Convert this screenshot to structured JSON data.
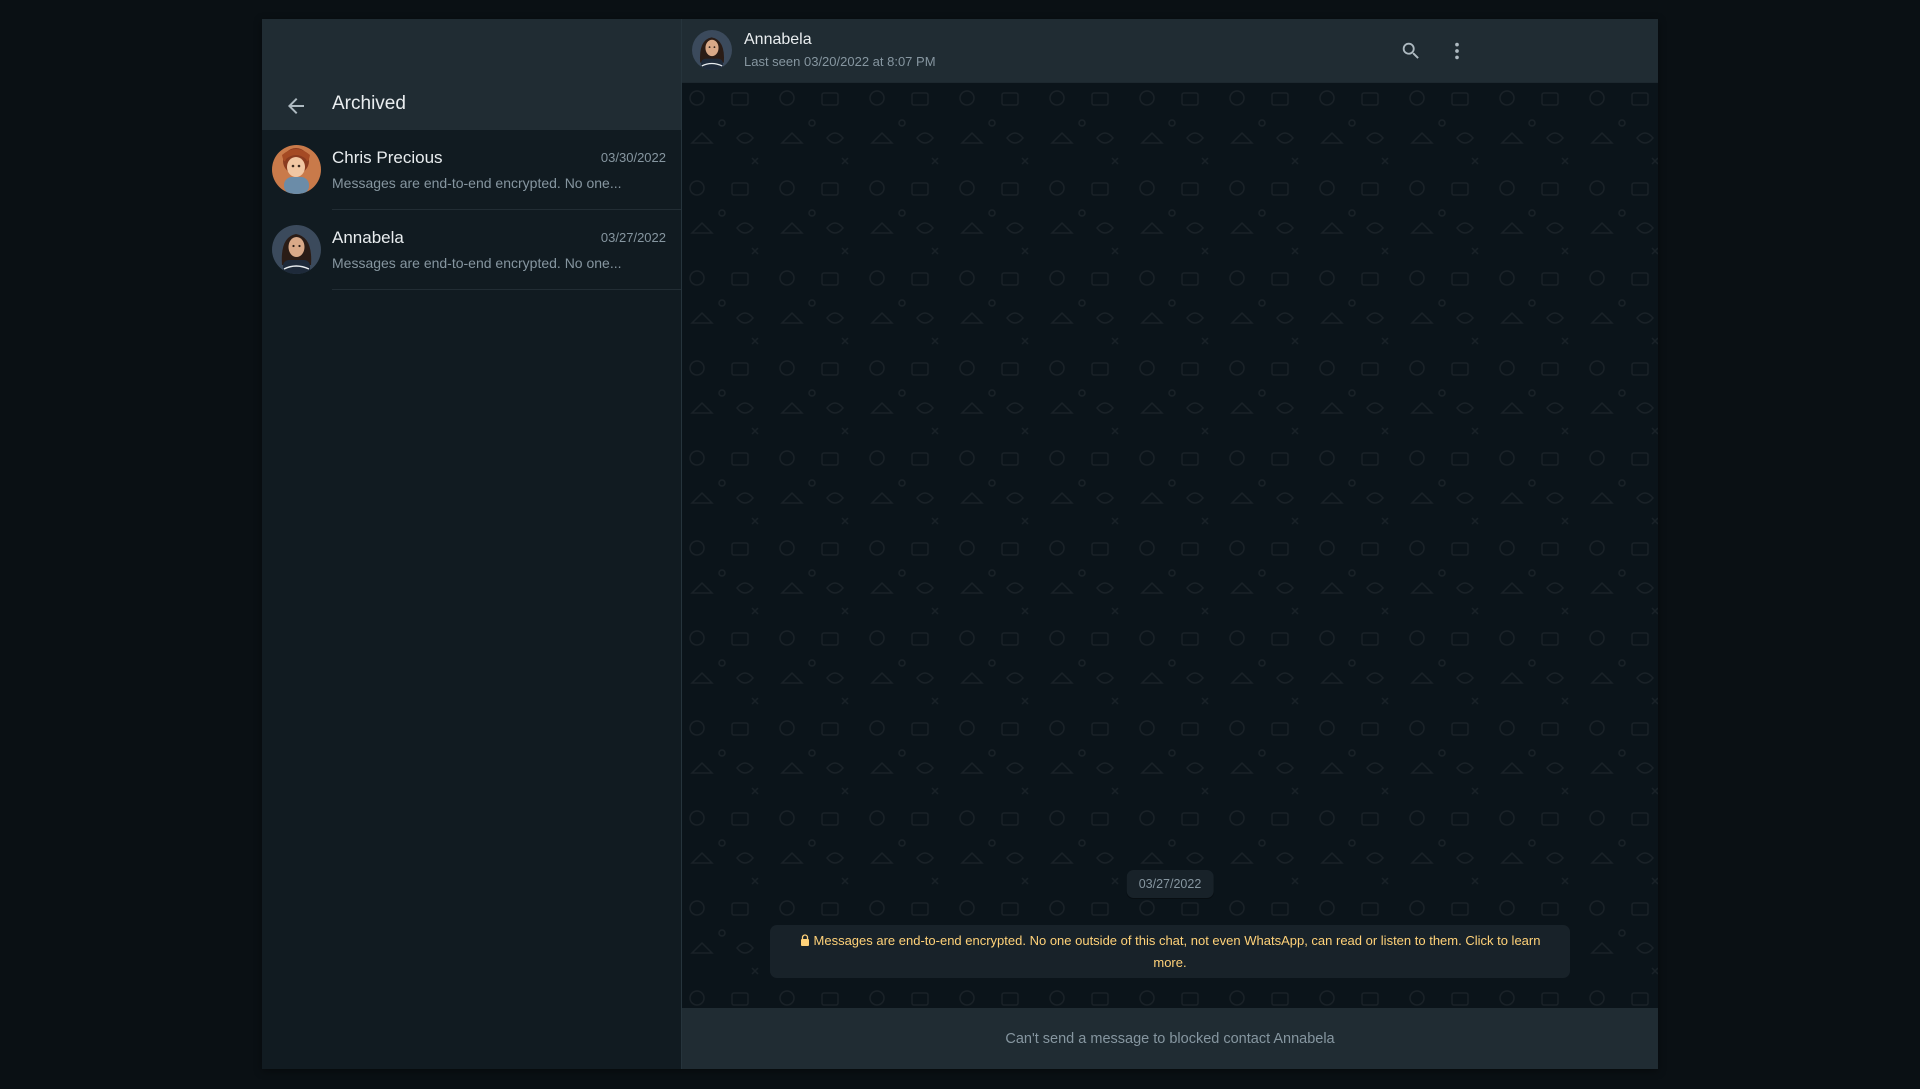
{
  "archived_panel": {
    "title": "Archived",
    "chats": [
      {
        "name": "Chris Precious",
        "date": "03/30/2022",
        "preview": "Messages are end-to-end encrypted. No one..."
      },
      {
        "name": "Annabela",
        "date": "03/27/2022",
        "preview": "Messages are end-to-end encrypted. No one..."
      }
    ]
  },
  "conversation": {
    "contact_name": "Annabela",
    "last_seen": "Last seen 03/20/2022 at 8:07 PM",
    "date_divider": "03/27/2022",
    "encryption_notice": "Messages are end-to-end encrypted. No one outside of this chat, not even WhatsApp, can read or listen to them. Click to learn more.",
    "footer_text": "Can't send a message to blocked contact Annabela"
  },
  "colors": {
    "panel_bg": "#111b21",
    "header_bg": "#202c33",
    "chat_bg": "#0b141a",
    "primary_text": "#e9edef",
    "secondary_text": "#8696a0",
    "notice_text": "#ffd279"
  },
  "icons": [
    "back-arrow-icon",
    "search-icon",
    "menu-dots-icon",
    "lock-icon"
  ]
}
